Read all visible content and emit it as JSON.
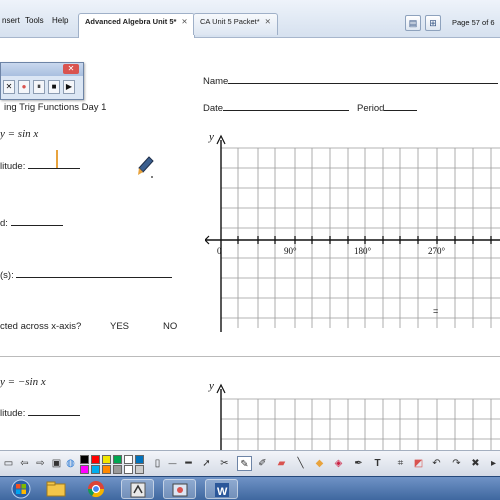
{
  "menu": {
    "items": [
      "nsert",
      "Tools",
      "Help"
    ]
  },
  "tabs": [
    {
      "label": "Advanced Algebra Unit 5*",
      "close": "✕"
    },
    {
      "label": "CA Unit 5 Packet*",
      "close": "✕"
    }
  ],
  "page_indicator": "Page 57 of 6",
  "worksheet": {
    "lesson_title": "ing Trig Functions Day 1",
    "name_label": "Name",
    "date_label": "Date",
    "period_label": "Period",
    "problem1": {
      "equation": "y = sin x",
      "amplitude_label": "litude:",
      "period_label": "d:",
      "xint_label": "(s):",
      "reflect_label": "cted across x-axis?",
      "yes": "YES",
      "no": "NO"
    },
    "graph1": {
      "y_label": "y",
      "origin": "0",
      "tick_labels": [
        "90°",
        "180°",
        "270°"
      ],
      "stray_mark": "="
    },
    "problem2": {
      "equation": "y = −sin x",
      "amplitude_label": "litude:"
    },
    "graph2": {
      "y_label": "y"
    }
  },
  "recorder": {
    "close": "✕",
    "buttons": [
      "✕",
      "●",
      "⏸",
      "■",
      "▶"
    ]
  },
  "colors": {
    "accent": "#e8a33d",
    "record": "#d9534f",
    "swatches": [
      "#000000",
      "#ff0000",
      "#f2e600",
      "#00a651",
      "#ffffff",
      "#0072bc",
      "#ff00ff",
      "#00aeef",
      "#ff8800",
      "#999999",
      "#ffffff",
      "#cccccc"
    ]
  },
  "taskbar": {
    "apps": [
      "start-orb",
      "file-explorer",
      "chrome",
      "notebook",
      "recorder",
      "word"
    ]
  }
}
